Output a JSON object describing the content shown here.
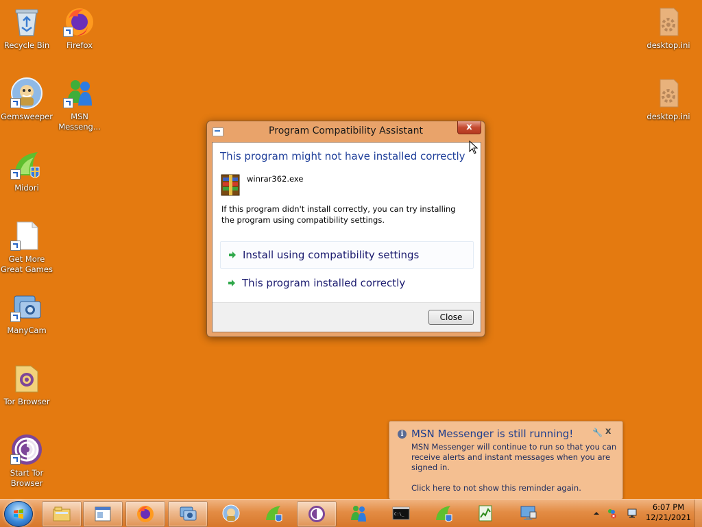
{
  "desktop": {
    "icons": [
      {
        "label": "Recycle Bin"
      },
      {
        "label": "Firefox"
      },
      {
        "label": "Gemsweeper"
      },
      {
        "label": "MSN Messeng..."
      },
      {
        "label": "Midori"
      },
      {
        "label": "Get More Great Games"
      },
      {
        "label": "ManyCam"
      },
      {
        "label": "Tor Browser"
      },
      {
        "label": "Start Tor Browser"
      },
      {
        "label": "desktop.ini"
      },
      {
        "label": "desktop.ini"
      }
    ]
  },
  "dialog": {
    "title": "Program Compatibility Assistant",
    "close_glyph": "x",
    "heading": "This program might not have installed correctly",
    "program_name": "winrar362.exe",
    "description": "If this program didn't install correctly, you can try installing the program using compatibility settings.",
    "options": [
      {
        "label": "Install using compatibility settings"
      },
      {
        "label": "This program installed correctly"
      }
    ],
    "close_button": "Close"
  },
  "notification": {
    "title": "MSN Messenger is still running!",
    "body": "MSN Messenger will continue to run so that you can receive alerts and instant messages when you are signed in.",
    "link": "Click here to not show this reminder again.",
    "close_glyph": "x"
  },
  "taskbar": {
    "pinned": [
      "explorer-icon",
      "window-icon",
      "firefox-icon",
      "manycam-icon",
      "gemsweeper-icon",
      "midori-icon",
      "tor-browser-icon",
      "msn-messenger-icon",
      "command-prompt-icon",
      "midori-icon",
      "monitor-app-icon",
      "remote-desktop-icon"
    ],
    "clock": {
      "time": "6:07 PM",
      "date": "12/21/2021"
    }
  },
  "colors": {
    "desktop_bg": "#e47a10",
    "taskbar": "#e38c44",
    "heading": "#1f3f9a",
    "notification_bg": "#f4bf91"
  }
}
